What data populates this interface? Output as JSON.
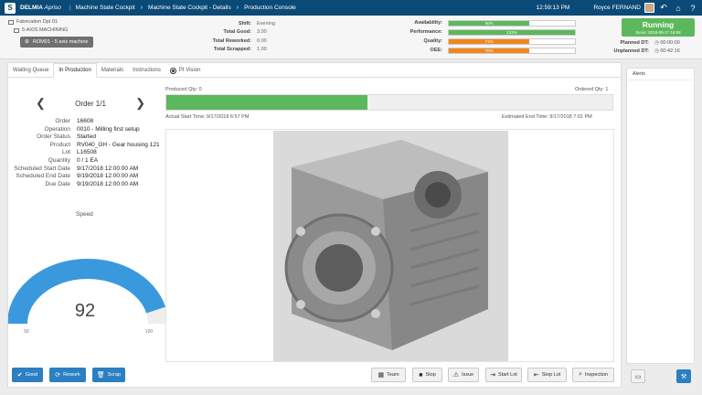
{
  "topbar": {
    "brand": "DELMIA",
    "brand_sub": "Apriso",
    "crumbs": [
      "Machine State Cockpit",
      "Machine State Cockpit - Details",
      "Production Console"
    ],
    "clock": "12:59:13 PM",
    "user": "Royce FERNAND"
  },
  "header": {
    "facility": "Fabrication Dpt 01",
    "area": "5-AXIS MACHINING",
    "machine": "ROM01 - 5 axis machine",
    "stats": [
      {
        "label": "Shift:",
        "value": "Evening"
      },
      {
        "label": "Total Good:",
        "value": "3.00"
      },
      {
        "label": "Total Reworked:",
        "value": "0.00"
      },
      {
        "label": "Total Scrapped:",
        "value": "1.00"
      }
    ],
    "kpis": [
      {
        "label": "Availability:",
        "text": "90%",
        "fraction": 0.64,
        "color": "#5cb85c"
      },
      {
        "label": "Performance:",
        "text": "133%",
        "fraction": 1.0,
        "color": "#5cb85c"
      },
      {
        "label": "Quality:",
        "text": "71%",
        "fraction": 0.64,
        "color": "#f0861e"
      },
      {
        "label": "OEE:",
        "text": "70%",
        "fraction": 0.64,
        "color": "#f0861e"
      }
    ],
    "status": "Running",
    "since": "Since: 2018-09-17 16:58",
    "planned_dt_label": "Planned DT:",
    "planned_dt": "00:00:00",
    "unplanned_dt_label": "Unplanned DT:",
    "unplanned_dt": "00:42:16"
  },
  "tabs": [
    "Waiting Queue",
    "In Production",
    "Materials",
    "Instructions",
    "PI Vision"
  ],
  "order": {
    "title": "Order 1/1",
    "details": [
      {
        "label": "Order",
        "value": "16608"
      },
      {
        "label": "Operation",
        "value": "0010 - Milling first setup"
      },
      {
        "label": "Order Status",
        "value": "Started"
      },
      {
        "label": "Product",
        "value": "RV040_GH - Gear housing 121"
      },
      {
        "label": "Lot",
        "value": "L16508"
      },
      {
        "label": "Quantity",
        "value": "0 / 1 EA"
      },
      {
        "label": "Scheduled Start Date",
        "value": "9/17/2018 12:00:00 AM"
      },
      {
        "label": "Scheduled End Date",
        "value": "9/19/2018 12:00:00 AM"
      },
      {
        "label": "Due Date",
        "value": "9/19/2018 12:00:00 AM"
      }
    ]
  },
  "speed": {
    "label": "Speed",
    "value": "92",
    "fraction": 0.92,
    "min": "50",
    "max": "100"
  },
  "production": {
    "produced": "Produced Qty: 0",
    "ordered": "Ordered Qty: 1",
    "progress_fraction": 0.45,
    "start_time": "Actual Start Time: 9/17/2018 6:57 PM",
    "end_time": "Estimated End Time: 9/17/2018 7:01 PM"
  },
  "actions": {
    "good": "Good",
    "rework": "Rework",
    "scrap": "Scrap",
    "team": "Team",
    "stop": "Stop",
    "issue": "Issue",
    "start_lot": "Start Lot",
    "stop_lot": "Stop Lot",
    "inspection": "Inspection"
  },
  "alerts": {
    "title": "Alerts"
  }
}
